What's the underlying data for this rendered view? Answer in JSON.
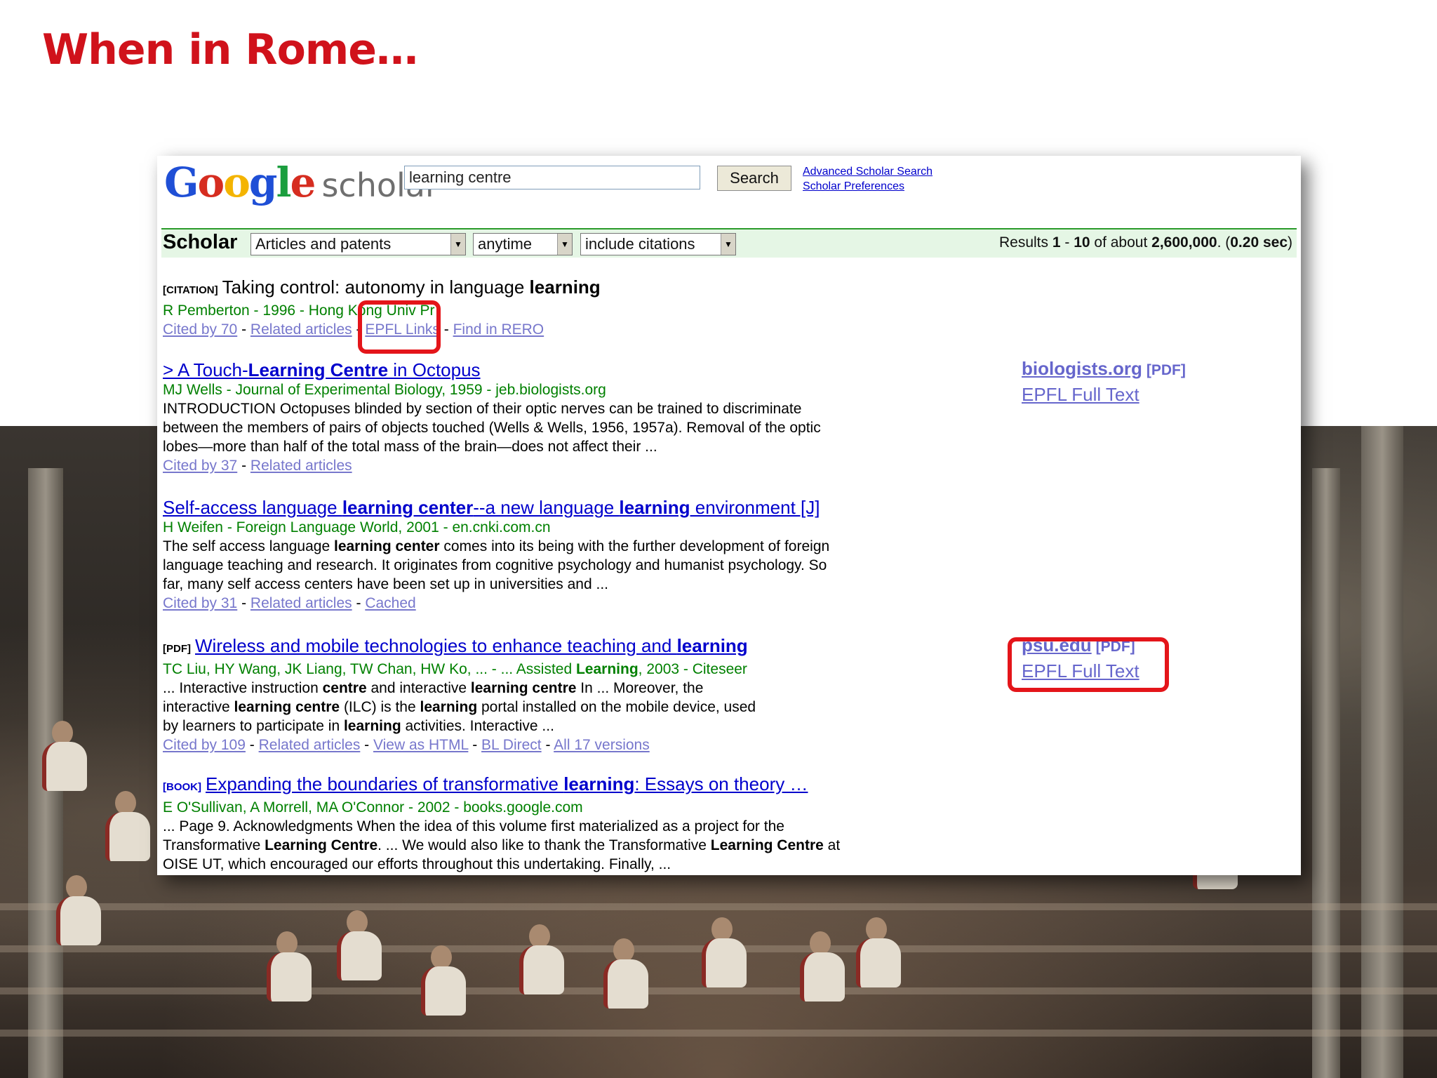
{
  "slide": {
    "title": "When in Rome…"
  },
  "scholar": {
    "logo_google": [
      "G",
      "o",
      "o",
      "g",
      "l",
      "e"
    ],
    "logo_colors": [
      "#1f4fd6",
      "#d62d20",
      "#f4b400",
      "#1f4fd6",
      "#1b9e3e",
      "#d62d20"
    ],
    "logo_word": "scholar",
    "search_value": "learning centre",
    "search_button": "Search",
    "advanced_link": "Advanced Scholar Search",
    "prefs_link": "Scholar Preferences",
    "bar_label": "Scholar",
    "filter_type": "Articles and patents",
    "filter_time": "anytime",
    "filter_citations": "include citations",
    "results": {
      "prefix": "Results ",
      "from": "1",
      "sep": " - ",
      "to": "10",
      "of": " of about ",
      "total": "2,600,000",
      "dot": ". (",
      "time": "0.20 sec",
      "close": ")"
    }
  },
  "results": [
    {
      "tag": "[CITATION]",
      "title_pre": "Taking control: autonomy in language ",
      "title_bold": "learning",
      "meta": "R Pemberton - 1996 - Hong Kong Univ Pr",
      "links": [
        "Cited by 70",
        "Related articles",
        "EPFL Links",
        "Find in RERO"
      ]
    },
    {
      "title_a": "> A Touch-",
      "title_b": "Learning Centre",
      "title_c": " in Octopus",
      "meta": "MJ Wells - Journal of Experimental Biology, 1959 - jeb.biologists.org",
      "snippet": "INTRODUCTION Octopuses blinded by section of their optic nerves can be trained to discriminate between the members of pairs of objects touched (Wells & Wells, 1956, 1957a). Removal of the optic lobes—more than half of the total mass of the brain—does not affect their ...",
      "links": [
        "Cited by 37",
        "Related articles"
      ],
      "side_domain": "biologists.org",
      "side_pdf": "[PDF]",
      "side_fulltext": "EPFL Full Text"
    },
    {
      "title_a": "Self-access language ",
      "title_b": "learning center",
      "title_c": "--a new language ",
      "title_d": "learning",
      "title_e": " environment [J]",
      "meta": "H Weifen - Foreign Language World, 2001 - en.cnki.com.cn",
      "snip_1": "The self access language ",
      "snip_2": "learning center",
      "snip_3": " comes into its being with the further development of foreign language teaching and research. It originates from cognitive psychology and humanist psychology. So far, many self access centers have been set up in universities and ...",
      "links": [
        "Cited by 31",
        "Related articles",
        "Cached"
      ]
    },
    {
      "tag": "[PDF]",
      "title_a": "Wireless and mobile technologies to enhance teaching and ",
      "title_b": "learning",
      "meta_a": "TC Liu, HY Wang, JK Liang, TW Chan, HW Ko, ... - ... Assisted ",
      "meta_b": "Learning",
      "meta_c": ", 2003 - Citeseer",
      "s1": "... Interactive instruction ",
      "s2": "centre",
      "s3": " and interactive ",
      "s4": "learning centre",
      "s5": " In ... Moreover, the interactive ",
      "s6": "learning centre",
      "s7": " (ILC) is the ",
      "s8": "learning",
      "s9": " portal installed on the mobile device, used by learners to participate in ",
      "s10": "learning",
      "s11": " activities. Interactive ...",
      "links": [
        "Cited by 109",
        "Related articles",
        "View as HTML",
        "BL Direct",
        "All 17 versions"
      ],
      "side_domain": "psu.edu",
      "side_pdf": "[PDF]",
      "side_fulltext": "EPFL Full Text"
    },
    {
      "tag": "[BOOK]",
      "title_a": "Expanding the boundaries of transformative ",
      "title_b": "learning",
      "title_c": ": Essays on theory …",
      "meta": "E O'Sullivan, A Morrell, MA O'Connor - 2002 - books.google.com",
      "s1": "... Page 9. Acknowledgments When the idea of this volume first materialized as a project for the Transformative ",
      "s2": "Learning Centre",
      "s3": ". ... We would also like to thank the Transformative ",
      "s4": "Learning Centre",
      "s5": " at OISE UT, which encouraged our efforts throughout this undertaking. Finally, ..."
    }
  ],
  "annotation_color": "#e4151a"
}
